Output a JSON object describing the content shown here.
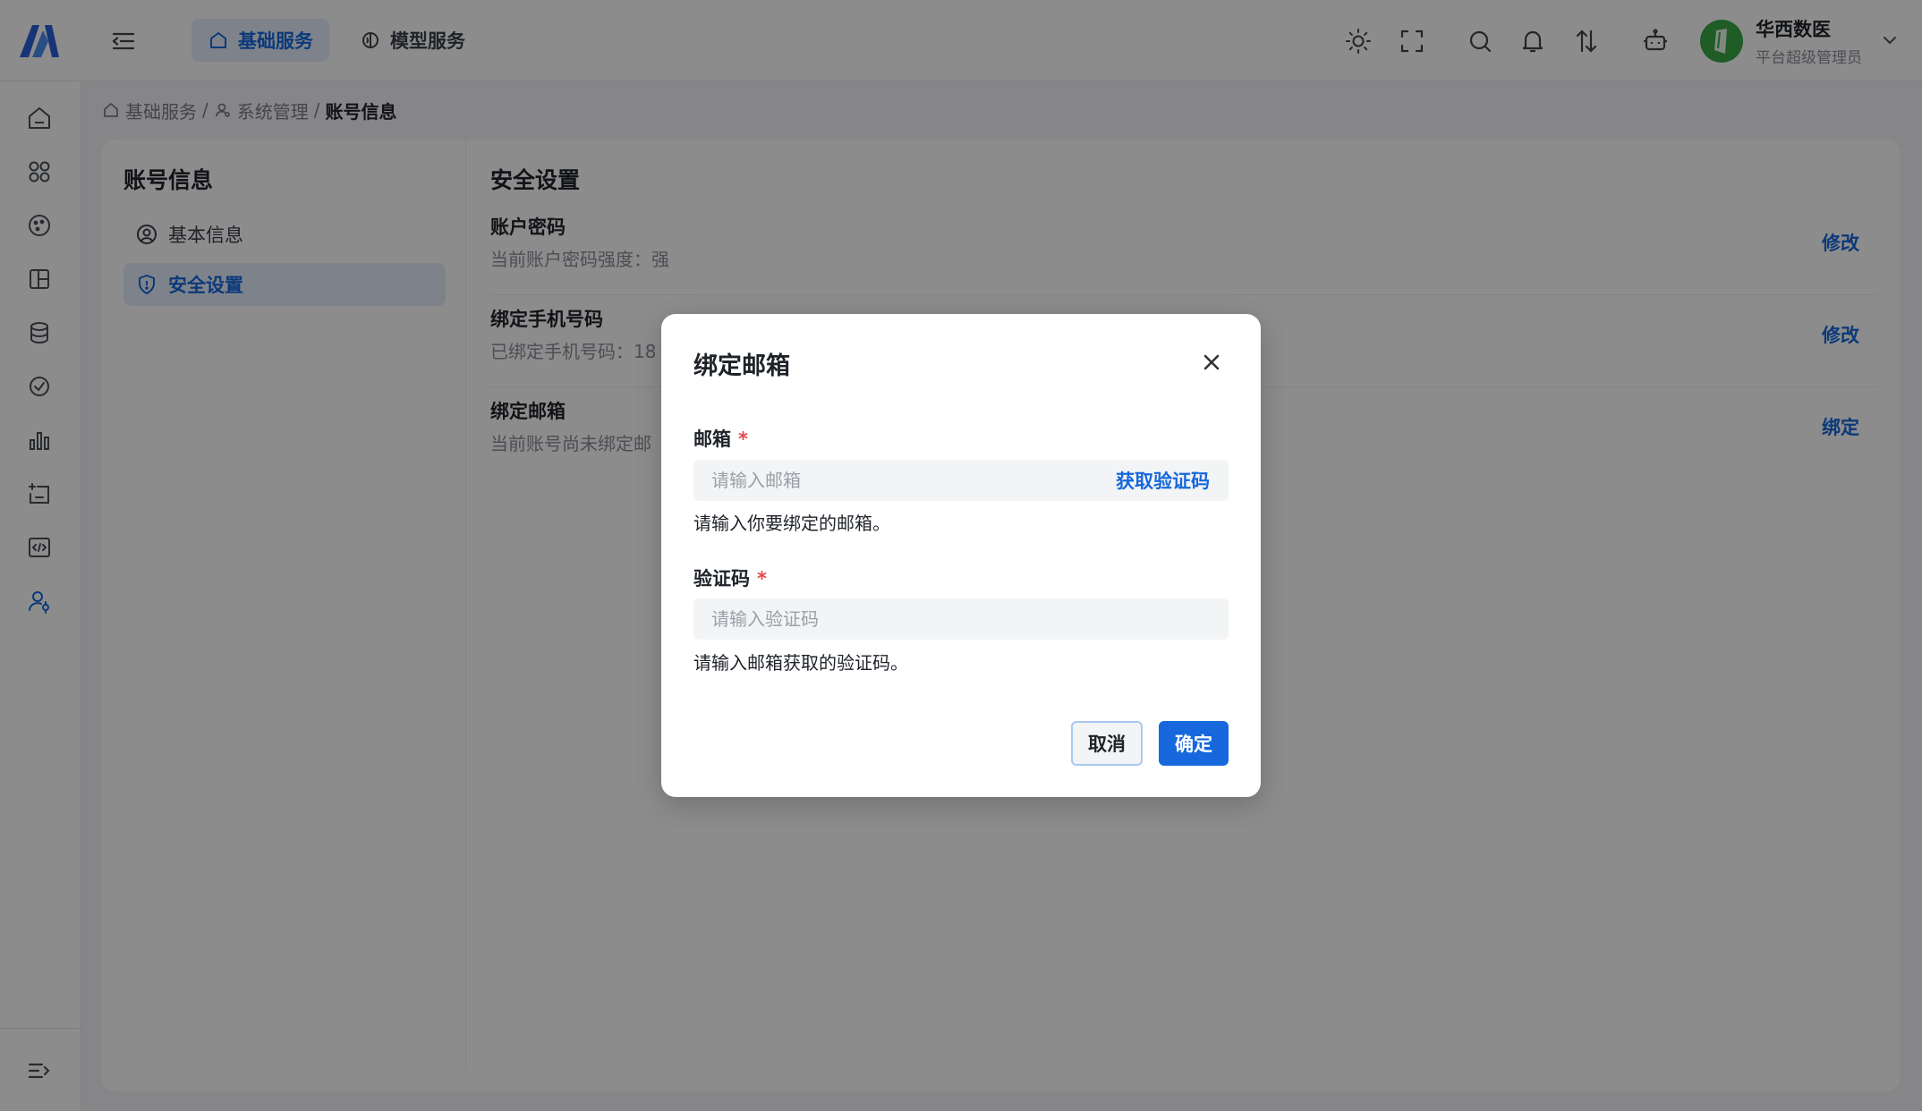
{
  "header": {
    "tabs": [
      {
        "label": "基础服务",
        "active": true
      },
      {
        "label": "模型服务",
        "active": false
      }
    ],
    "icons": [
      "sun-icon",
      "fullscreen-icon",
      "search-icon",
      "bell-icon",
      "sort-icon",
      "robot-icon"
    ],
    "user": {
      "name": "华西数医",
      "role": "平台超级管理员"
    }
  },
  "sidebar": {
    "icons": [
      "home-icon",
      "apps-icon",
      "palette-icon",
      "layout-icon",
      "database-icon",
      "check-circle-icon",
      "bar-chart-icon",
      "calendar-add-icon",
      "code-icon",
      "user-settings-icon"
    ],
    "collapse_icon": "collapse-icon"
  },
  "breadcrumb": {
    "items": [
      "基础服务",
      "系统管理",
      "账号信息"
    ],
    "separator": "/"
  },
  "account_panel": {
    "title": "账号信息",
    "items": [
      {
        "label": "基本信息",
        "active": false
      },
      {
        "label": "安全设置",
        "active": true
      }
    ]
  },
  "security": {
    "title": "安全设置",
    "rows": [
      {
        "label": "账户密码",
        "desc": "当前账户密码强度：强",
        "action": "修改"
      },
      {
        "label": "绑定手机号码",
        "desc": "已绑定手机号码：18",
        "action": "修改"
      },
      {
        "label": "绑定邮箱",
        "desc": "当前账号尚未绑定邮",
        "action": "绑定"
      }
    ]
  },
  "modal": {
    "title": "绑定邮箱",
    "email_label": "邮箱",
    "email_placeholder": "请输入邮箱",
    "get_code_label": "获取验证码",
    "email_help": "请输入你要绑定的邮箱。",
    "code_label": "验证码",
    "code_placeholder": "请输入验证码",
    "code_help": "请输入邮箱获取的验证码。",
    "required_mark": "*",
    "cancel_label": "取消",
    "confirm_label": "确定"
  },
  "colors": {
    "accent": "#1668dc",
    "required": "#e5484d",
    "avatar": "#3aa845"
  }
}
